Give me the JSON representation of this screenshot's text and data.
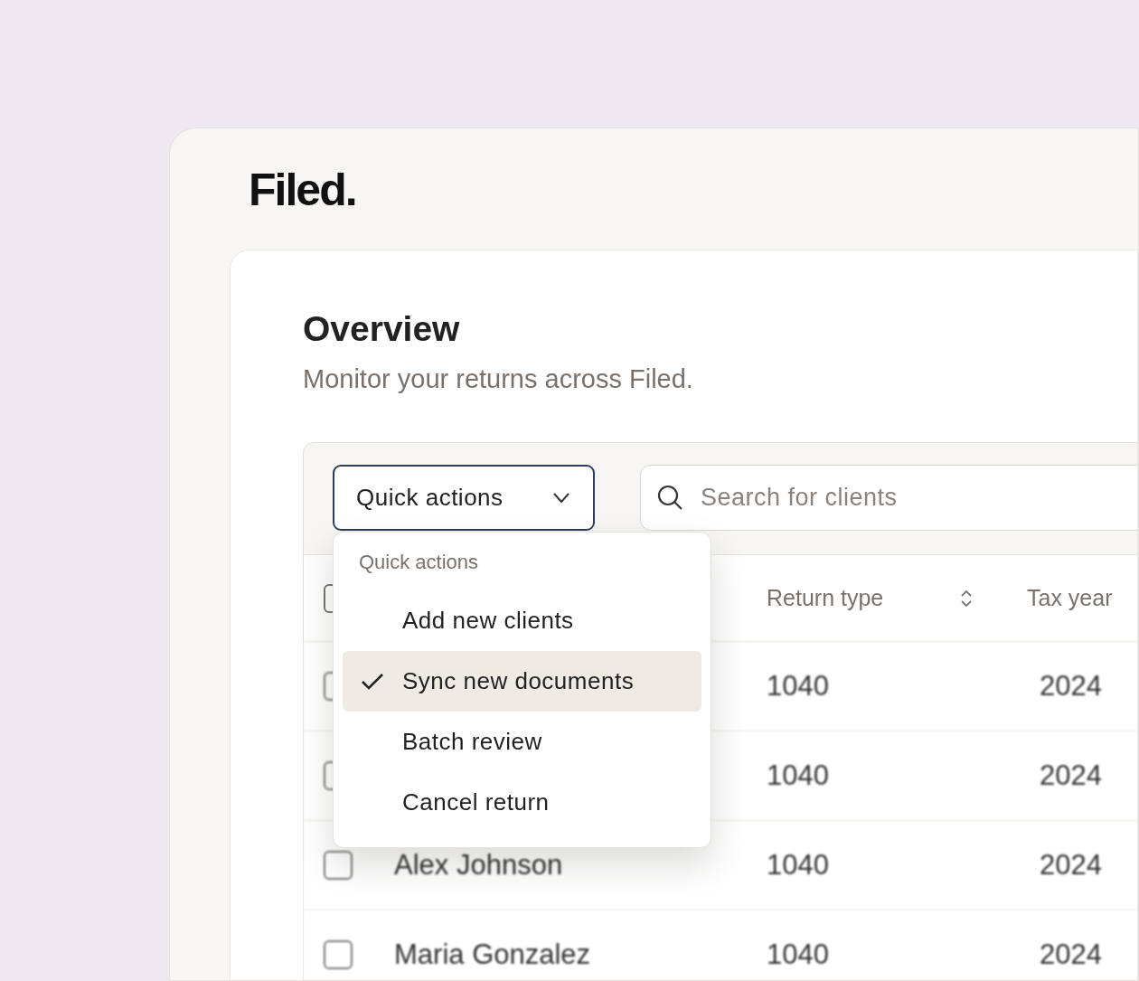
{
  "logo": "Filed.",
  "title": "Overview",
  "subtitle": "Monitor your returns across Filed.",
  "quick_actions_button": {
    "label": "Quick actions",
    "expanded": true
  },
  "search": {
    "placeholder": "Search for clients"
  },
  "menu": {
    "heading": "Quick actions",
    "items": [
      {
        "label": "Add new clients",
        "selected": false
      },
      {
        "label": "Sync new documents",
        "selected": true
      },
      {
        "label": "Batch review",
        "selected": false
      },
      {
        "label": "Cancel return",
        "selected": false
      }
    ]
  },
  "table": {
    "select_all_checked": false,
    "columns": [
      {
        "label": "Return type",
        "sortable": true
      },
      {
        "label": "Tax year",
        "sortable": false
      }
    ],
    "rows": [
      {
        "checked": false,
        "return_type": "1040",
        "tax_year": "2024"
      },
      {
        "checked": false,
        "return_type": "1040",
        "tax_year": "2024"
      },
      {
        "checked": false,
        "name": "Alex Johnson",
        "return_type": "1040",
        "tax_year": "2024"
      },
      {
        "checked": false,
        "name": "Maria Gonzalez",
        "return_type": "1040",
        "tax_year": "2024"
      }
    ]
  }
}
